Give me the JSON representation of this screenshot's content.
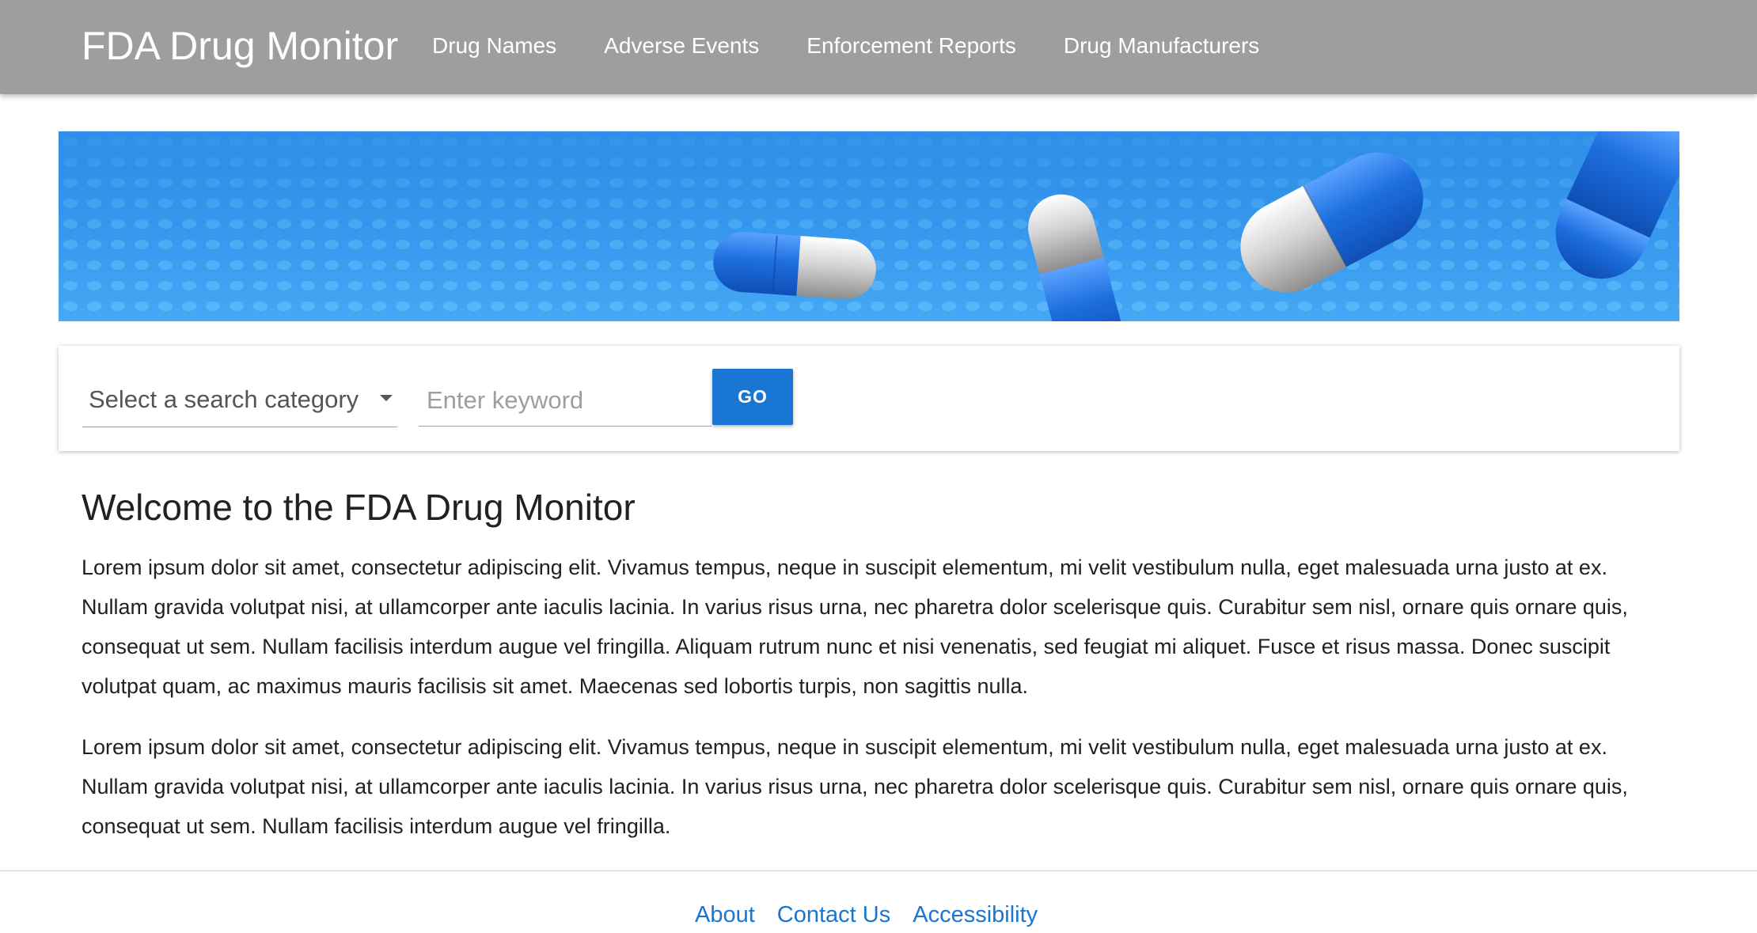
{
  "header": {
    "brand": "FDA Drug Monitor",
    "nav": [
      "Drug Names",
      "Adverse Events",
      "Enforcement Reports",
      "Drug Manufacturers"
    ]
  },
  "search": {
    "category_placeholder": "Select a search category",
    "keyword_placeholder": "Enter keyword",
    "go_label": "GO"
  },
  "main": {
    "title": "Welcome to the FDA Drug Monitor",
    "paragraphs": [
      "Lorem ipsum dolor sit amet, consectetur adipiscing elit. Vivamus tempus, neque in suscipit elementum, mi velit vestibulum nulla, eget malesuada urna justo at ex. Nullam gravida volutpat nisi, at ullamcorper ante iaculis lacinia. In varius risus urna, nec pharetra dolor scelerisque quis. Curabitur sem nisl, ornare quis ornare quis, consequat ut sem. Nullam facilisis interdum augue vel fringilla. Aliquam rutrum nunc et nisi venenatis, sed feugiat mi aliquet. Fusce et risus massa. Donec suscipit volutpat quam, ac maximus mauris facilisis sit amet. Maecenas sed lobortis turpis, non sagittis nulla.",
      "Lorem ipsum dolor sit amet, consectetur adipiscing elit. Vivamus tempus, neque in suscipit elementum, mi velit vestibulum nulla, eget malesuada urna justo at ex. Nullam gravida volutpat nisi, at ullamcorper ante iaculis lacinia. In varius risus urna, nec pharetra dolor scelerisque quis. Curabitur sem nisl, ornare quis ornare quis, consequat ut sem. Nullam facilisis interdum augue vel fringilla."
    ]
  },
  "footer": {
    "links": [
      "About",
      "Contact Us",
      "Accessibility"
    ]
  },
  "colors": {
    "header_bg": "#9e9e9e",
    "accent": "#1976d2",
    "banner_blue": "#2f8fe8",
    "capsule_blue": "#1e6fe0",
    "capsule_silver": "#c8c8c8"
  },
  "icons": {
    "select_caret": "caret-down-icon"
  }
}
